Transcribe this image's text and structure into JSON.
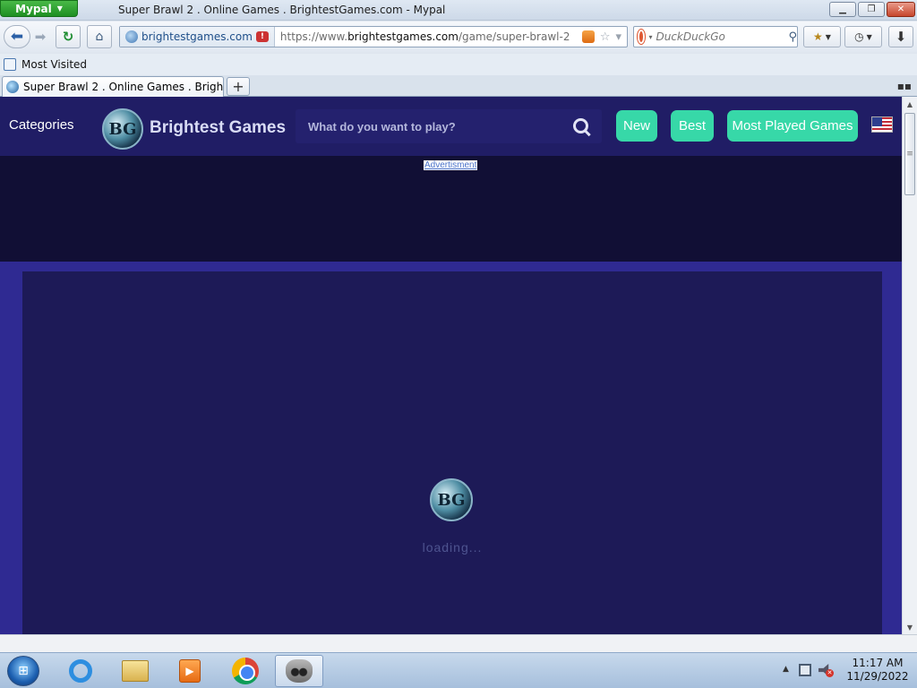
{
  "browser": {
    "app_menu_label": "Mypal",
    "window_title": "Super Brawl 2 . Online Games . BrightestGames.com - Mypal",
    "identity_host": "brightestgames.com",
    "url_prefix": "https://www.",
    "url_host": "brightestgames.com",
    "url_path": "/game/super-brawl-2",
    "search_placeholder": "DuckDuckGo",
    "bookmarks": [
      {
        "label": "Most Visited"
      }
    ],
    "tab_title": "Super Brawl 2 . Online Games . Brightest..."
  },
  "site": {
    "categories_label": "Categories",
    "name": "Brightest Games",
    "search_placeholder": "What do you want to play?",
    "nav": {
      "new": "New",
      "best": "Best",
      "most_played": "Most Played Games"
    },
    "ad_label": "Advertisment",
    "loading_text": "loading..."
  },
  "taskbar": {
    "time": "11:17 AM",
    "date": "11/29/2022"
  },
  "colors": {
    "accent_button": "#37d8a8",
    "header_bg": "#201d65",
    "page_bg": "#2f2a92",
    "titlebar_app_button": "#2aa332"
  }
}
